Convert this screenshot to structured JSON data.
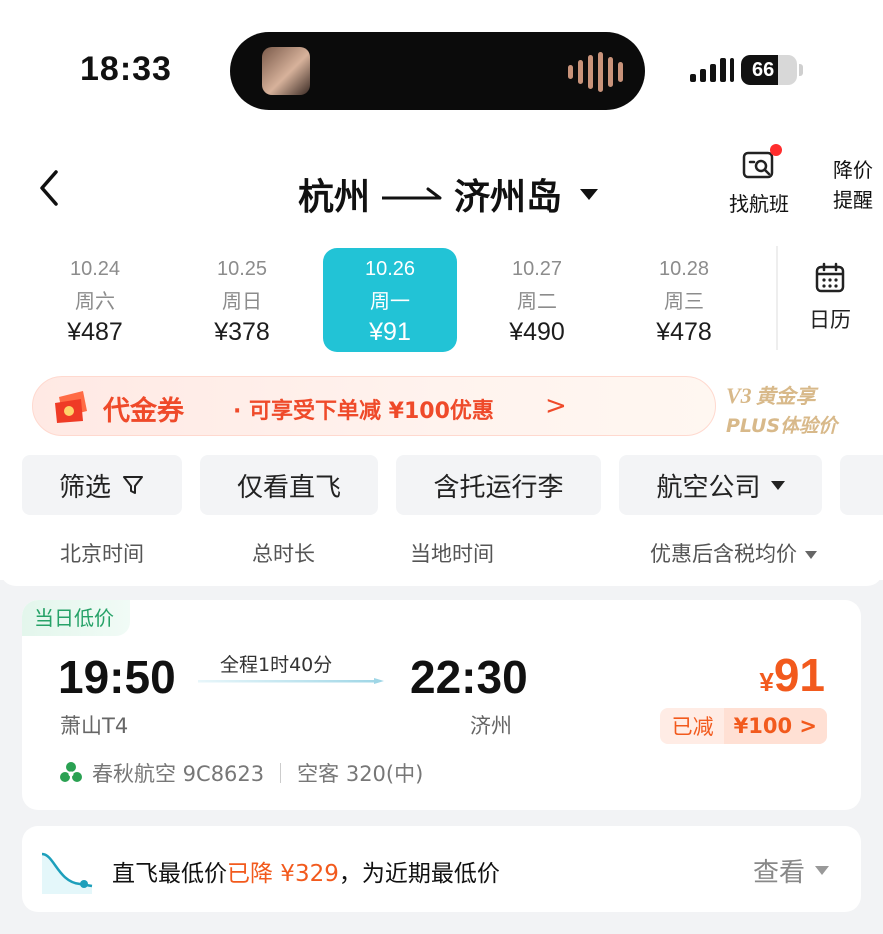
{
  "status_bar": {
    "time": "18:33",
    "battery": "66",
    "battery_level": 0.66
  },
  "header": {
    "origin": "杭州",
    "destination": "济州岛",
    "find_flight_label": "找航班",
    "price_alert_label": "降价提醒"
  },
  "dates": [
    {
      "date": "10.24",
      "weekday": "周六",
      "price": "¥487",
      "active": false
    },
    {
      "date": "10.25",
      "weekday": "周日",
      "price": "¥378",
      "active": false
    },
    {
      "date": "10.26",
      "weekday": "周一",
      "price": "¥91",
      "active": true
    },
    {
      "date": "10.27",
      "weekday": "周二",
      "price": "¥490",
      "active": false
    },
    {
      "date": "10.28",
      "weekday": "周三",
      "price": "¥478",
      "active": false
    }
  ],
  "calendar_label": "日历",
  "coupon": {
    "title": "代金券",
    "desc": "· 可享受下单减 ¥100优惠",
    "chevron": ">"
  },
  "plus": {
    "line1": "黄金享",
    "line2": "PLUS体验价",
    "level": "V3"
  },
  "filters": {
    "filter": "筛选",
    "direct_only": "仅看直飞",
    "with_baggage": "含托运行李",
    "airline": "航空公司"
  },
  "sort": {
    "beijing_time": "北京时间",
    "total_duration": "总时长",
    "local_time": "当地时间",
    "price_avg": "优惠后含税均价"
  },
  "flight": {
    "badge": "当日低价",
    "dep_time": "19:50",
    "dep_airport": "萧山T4",
    "duration": "全程1时40分",
    "arr_time": "22:30",
    "arr_airport": "济州",
    "currency": "¥",
    "price": "91",
    "discount_label": "已减",
    "discount_amount": "¥100 >",
    "airline": "春秋航空 9C8623",
    "aircraft": "空客 320(中)"
  },
  "promo": {
    "text_prefix": "直飞最低价",
    "text_highlight": "已降 ¥329",
    "text_suffix": "，为近期最低价",
    "view_label": "查看"
  },
  "colors": {
    "accent_cyan": "#22c3d6",
    "price_orange": "#f25a1d",
    "coupon_red": "#ef4a2a",
    "green_badge": "#26a268"
  }
}
